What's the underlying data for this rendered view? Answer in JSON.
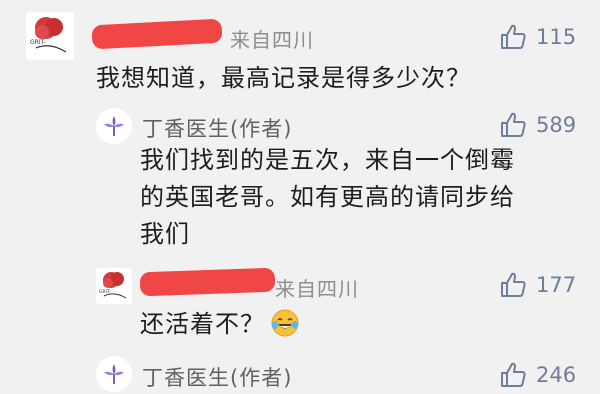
{
  "comments": [
    {
      "location": "来自四川",
      "likes": "115",
      "text": "我想知道，最高记录是得多少次？",
      "avatar_text": "GRIT-"
    },
    {
      "author": "丁香医生",
      "author_tag": "(作者)",
      "likes": "589",
      "text_lines": [
        "我们找到的是五次，来自一个倒霉",
        "的英国老哥。如有更高的请同步给",
        "我们"
      ]
    },
    {
      "location": "来自四川",
      "likes": "177",
      "text": "还活着不？",
      "emoji": "laughing-tears-emoji",
      "avatar_text": "GRIT-"
    },
    {
      "author": "丁香医生",
      "author_tag": "(作者)",
      "likes": "246"
    }
  ],
  "colors": {
    "like": "#6d7e9b",
    "meta": "#8e8e8e",
    "redaction": "#f04646",
    "brand": "#7a5fc0"
  }
}
